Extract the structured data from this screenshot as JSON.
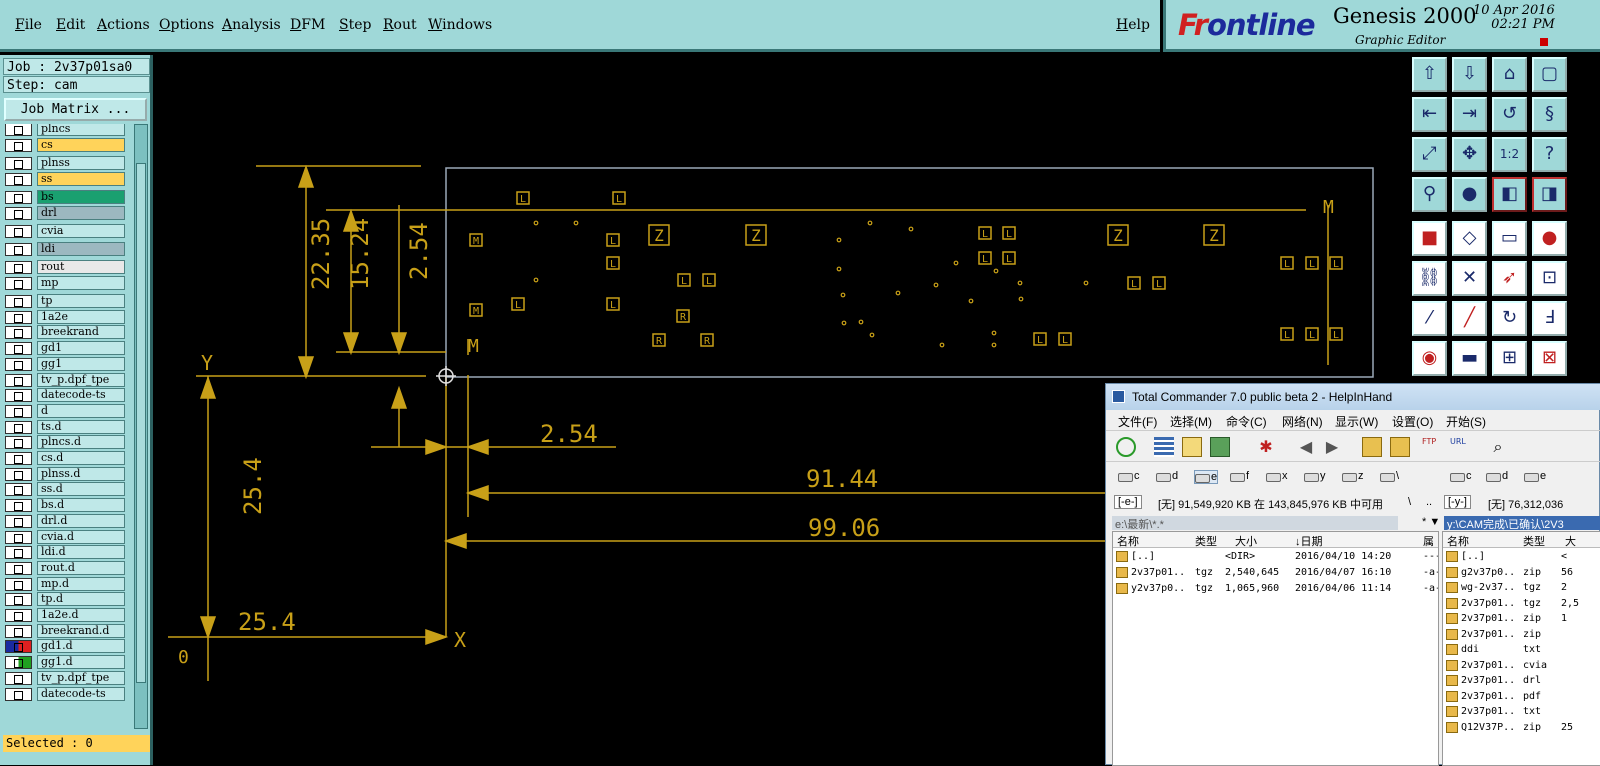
{
  "menubar": {
    "items": [
      "File",
      "Edit",
      "Actions",
      "Options",
      "Analysis",
      "DFM",
      "Step",
      "Rout",
      "Windows"
    ],
    "help": "Help"
  },
  "brand": {
    "logo_prefix": "Fr",
    "logo_rest": "ontline",
    "product": "Genesis 2000",
    "subtitle": "Graphic Editor",
    "date": "10 Apr 2016",
    "time": "02:21 PM"
  },
  "left_panel": {
    "job": "Job : 2v37p01sa0",
    "step": "Step: cam",
    "job_matrix": "Job Matrix ...",
    "selected": "Selected : 0",
    "layers": [
      {
        "name": "plncs",
        "color": "#bfe8e8"
      },
      {
        "name": "cs",
        "color": "#ffd35a"
      },
      {
        "name": "plnss",
        "color": "#bfe8e8"
      },
      {
        "name": "ss",
        "color": "#ffd35a"
      },
      {
        "name": "bs",
        "color": "#1aa070"
      },
      {
        "name": "drl",
        "color": "#9cb8c0"
      },
      {
        "name": "cvia",
        "color": "#bfe8e8"
      },
      {
        "name": "ldi",
        "color": "#9cb8c0"
      },
      {
        "name": "rout",
        "color": "#e8e8e8"
      },
      {
        "name": "mp",
        "color": "#bfe8e8"
      },
      {
        "name": "tp",
        "color": "#bfe8e8"
      },
      {
        "name": "1a2e",
        "color": "#bfe8e8"
      },
      {
        "name": "breekrand",
        "color": "#bfe8e8"
      },
      {
        "name": "gd1",
        "color": "#bfe8e8"
      },
      {
        "name": "gg1",
        "color": "#bfe8e8"
      },
      {
        "name": "tv_p.dpf_tpe",
        "color": "#bfe8e8"
      },
      {
        "name": "datecode-ts",
        "color": "#bfe8e8"
      },
      {
        "name": "d",
        "color": "#bfe8e8"
      },
      {
        "name": "ts.d",
        "color": "#bfe8e8"
      },
      {
        "name": "plncs.d",
        "color": "#bfe8e8"
      },
      {
        "name": "cs.d",
        "color": "#bfe8e8"
      },
      {
        "name": "plnss.d",
        "color": "#bfe8e8"
      },
      {
        "name": "ss.d",
        "color": "#bfe8e8"
      },
      {
        "name": "bs.d",
        "color": "#bfe8e8"
      },
      {
        "name": "drl.d",
        "color": "#bfe8e8"
      },
      {
        "name": "cvia.d",
        "color": "#bfe8e8"
      },
      {
        "name": "ldi.d",
        "color": "#bfe8e8"
      },
      {
        "name": "rout.d",
        "color": "#bfe8e8"
      },
      {
        "name": "mp.d",
        "color": "#bfe8e8"
      },
      {
        "name": "tp.d",
        "color": "#bfe8e8"
      },
      {
        "name": "1a2e.d",
        "color": "#bfe8e8"
      },
      {
        "name": "breekrand.d",
        "color": "#bfe8e8"
      },
      {
        "name": "gd1.d",
        "color": "#bfe8e8"
      },
      {
        "name": "gg1.d",
        "color": "#bfe8e8"
      },
      {
        "name": "tv_p.dpf_tpe",
        "color": "#bfe8e8"
      },
      {
        "name": "datecode-ts",
        "color": "#bfe8e8"
      }
    ]
  },
  "canvas": {
    "dimensions": [
      "22.35",
      "15.24",
      "2.54",
      "2.54",
      "91.44",
      "99.06",
      "25.4",
      "25.4"
    ],
    "axis_x": "X",
    "axis_y": "Y",
    "origin": "0",
    "pad_letters": [
      "L",
      "M",
      "Z",
      "R"
    ],
    "line_color": "#c8a018"
  },
  "total_commander": {
    "title": "Total Commander 7.0 public beta 2 - HelpInHand",
    "menu": [
      "文件(F)",
      "选择(M)",
      "命令(C)",
      "网络(N)",
      "显示(W)",
      "设置(O)",
      "开始(S)"
    ],
    "left_drives": [
      "c",
      "d",
      "e",
      "f",
      "x",
      "y",
      "z",
      "\\"
    ],
    "right_drives": [
      "c",
      "d",
      "e"
    ],
    "left_drive_sel": "[-e-]",
    "right_drive_sel": "[-y-]",
    "left_drive_info": "[无] 91,549,920 KB 在 143,845,976 KB 中可用",
    "right_drive_info": "[无] 76,312,036",
    "left_sep": "\\",
    "left_dots": "..",
    "left_path": "e:\\最新\\*.*",
    "left_path_tail": "* ▼",
    "right_path": "y:\\CAM完成\\已确认\\2V3",
    "left_headers": [
      "名称",
      "类型",
      "大小",
      "↓日期",
      "属"
    ],
    "right_headers": [
      "名称",
      "类型",
      "大"
    ],
    "left_rows": [
      {
        "name": "[..]",
        "ext": "",
        "size": "<DIR>",
        "date": "2016/04/10 14:20",
        "attr": "----"
      },
      {
        "name": "2v37p01..",
        "ext": "tgz",
        "size": "2,540,645",
        "date": "2016/04/07 16:10",
        "attr": "-a-"
      },
      {
        "name": "y2v37p0..",
        "ext": "tgz",
        "size": "1,065,960",
        "date": "2016/04/06 11:14",
        "attr": "-a-"
      }
    ],
    "right_rows": [
      {
        "name": "[..]",
        "ext": "",
        "size": "<"
      },
      {
        "name": "g2v37p0..",
        "ext": "zip",
        "size": "56"
      },
      {
        "name": "wg-2v37..",
        "ext": "tgz",
        "size": "2"
      },
      {
        "name": "2v37p01..",
        "ext": "tgz",
        "size": "2,5"
      },
      {
        "name": "2v37p01..",
        "ext": "zip",
        "size": "1"
      },
      {
        "name": "2v37p01..",
        "ext": "zip",
        "size": ""
      },
      {
        "name": "ddi",
        "ext": "txt",
        "size": ""
      },
      {
        "name": "2v37p01..",
        "ext": "cvia",
        "size": ""
      },
      {
        "name": "2v37p01..",
        "ext": "drl",
        "size": ""
      },
      {
        "name": "2v37p01..",
        "ext": "pdf",
        "size": ""
      },
      {
        "name": "2v37p01..",
        "ext": "txt",
        "size": ""
      },
      {
        "name": "Q12V37P..",
        "ext": "zip",
        "size": "25"
      }
    ]
  },
  "toolbar_icons": [
    "step-up-icon",
    "step-down-icon",
    "home-icon",
    "window-icon",
    "zoom-left-icon",
    "zoom-right-icon",
    "rotate-icon",
    "mirror-icon",
    "fit-all-icon",
    "center-icon",
    "ratio-icon",
    "help-icon",
    "measure-icon",
    "snap-icon",
    "feature-select-icon",
    "net-select-icon",
    "pad-icon",
    "add-icon",
    "ruler-icon",
    "dot-icon",
    "connect-icon",
    "cross-icon",
    "move-icon",
    "pad-red-icon",
    "line-icon",
    "arc-icon",
    "undo-icon",
    "filter-icon",
    "surface-icon",
    "line-red-icon",
    "zoom-box-icon",
    "grid-icon"
  ]
}
